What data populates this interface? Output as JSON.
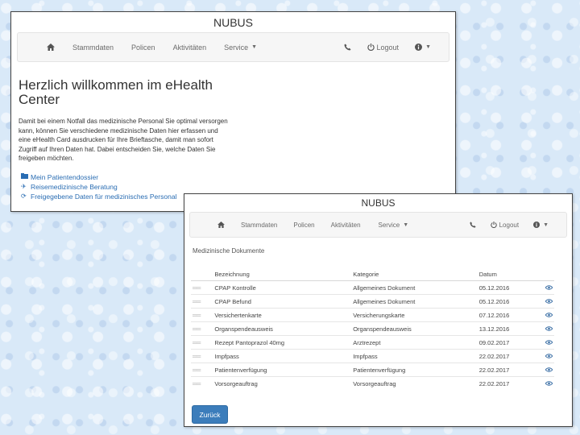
{
  "window1": {
    "brand": "NUBUS",
    "nav": {
      "home_icon": "home-icon",
      "items": [
        {
          "label": "Stammdaten"
        },
        {
          "label": "Policen"
        },
        {
          "label": "Aktivitäten"
        },
        {
          "label": "Service"
        }
      ],
      "logout_label": "Logout",
      "phone_icon": "phone-icon",
      "power_icon": "power-icon",
      "info_icon": "info-icon"
    },
    "heading": "Herzlich willkommen im eHealth Center",
    "intro": "Damit bei einem Notfall das medizinische Personal Sie optimal versorgen kann, können Sie verschiedene medizinische Daten hier erfassen und eine eHealth Card ausdrucken für Ihre Brieftasche, damit man sofort Zugriff auf Ihren Daten hat. Dabei entscheiden Sie, welche Daten Sie freigeben möchten.",
    "links": [
      {
        "icon": "folder-icon",
        "label": "Mein Patientendossier"
      },
      {
        "icon": "plane-icon",
        "label": "Reisemedizinische Beratung"
      },
      {
        "icon": "refresh-icon",
        "label": "Freigegebene Daten für medizinisches Personal"
      }
    ]
  },
  "window2": {
    "brand": "NUBUS",
    "nav": {
      "items": [
        {
          "label": "Stammdaten"
        },
        {
          "label": "Policen"
        },
        {
          "label": "Aktivitäten"
        },
        {
          "label": "Service"
        }
      ],
      "logout_label": "Logout"
    },
    "section_title": "Medizinische Dokumente",
    "table": {
      "headers": [
        "",
        "Bezeichnung",
        "Kategorie",
        "Datum",
        ""
      ],
      "rows": [
        {
          "name": "CPAP Kontrolle",
          "category": "Allgemeines Dokument",
          "date": "05.12.2016"
        },
        {
          "name": "CPAP Befund",
          "category": "Allgemeines Dokument",
          "date": "05.12.2016"
        },
        {
          "name": "Versichertenkarte",
          "category": "Versicherungskarte",
          "date": "07.12.2016"
        },
        {
          "name": "Organspendeausweis",
          "category": "Organspendeausweis",
          "date": "13.12.2016"
        },
        {
          "name": "Rezept Pantoprazol 40mg",
          "category": "Arztrezept",
          "date": "09.02.2017"
        },
        {
          "name": "Impfpass",
          "category": "Impfpass",
          "date": "22.02.2017"
        },
        {
          "name": "Patientenverfügung",
          "category": "Patientenverfügung",
          "date": "22.02.2017"
        },
        {
          "name": "Vorsorgeauftrag",
          "category": "Vorsorgeauftrag",
          "date": "22.02.2017"
        }
      ]
    },
    "back_button": "Zurück"
  },
  "colors": {
    "accent": "#3c7dbb",
    "link": "#2a6db3",
    "navbar_bg": "#f6f6f6",
    "page_bg": "#d9e9f8"
  }
}
